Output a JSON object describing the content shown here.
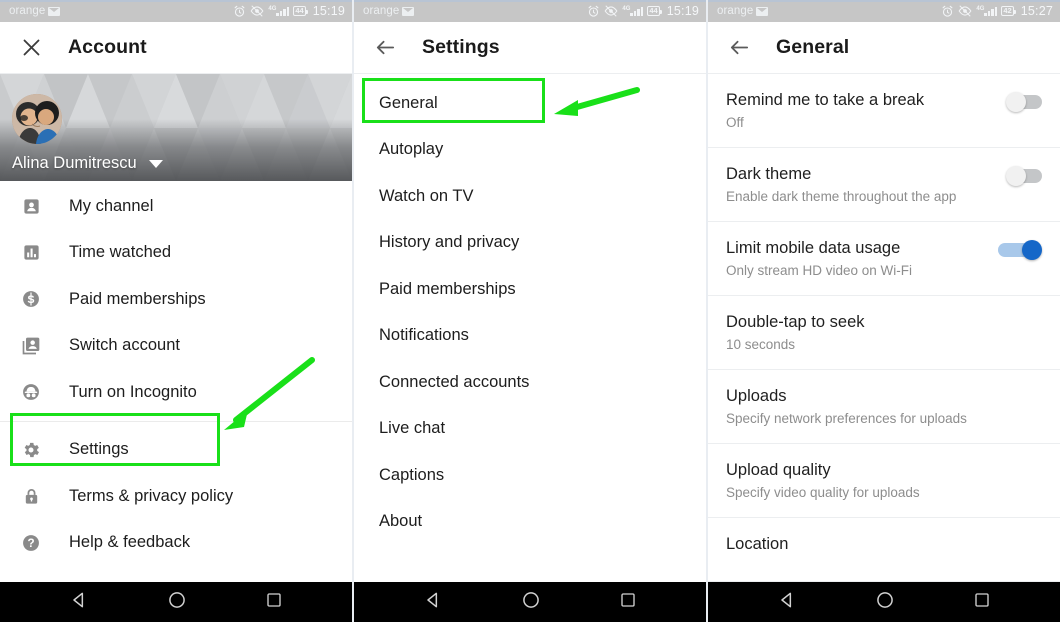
{
  "panels": [
    {
      "id": "account",
      "statusbar": {
        "carrier": "orange",
        "network": "4G",
        "battery": "44",
        "time": "15:19"
      },
      "appbar": {
        "nav_icon": "close-icon",
        "title": "Account"
      },
      "banner": {
        "account_name": "Alina Dumitrescu",
        "caret_icon": "chevron-down-icon",
        "avatar": "user-avatar"
      },
      "items": [
        {
          "label": "My channel",
          "icon": "account-box-icon"
        },
        {
          "label": "Time watched",
          "icon": "bar-chart-icon"
        },
        {
          "label": "Paid memberships",
          "icon": "dollar-circle-icon"
        },
        {
          "label": "Switch account",
          "icon": "switch-account-icon"
        },
        {
          "label": "Turn on Incognito",
          "icon": "incognito-icon"
        },
        {
          "label": "Settings",
          "icon": "gear-icon",
          "highlighted": true
        },
        {
          "label": "Terms & privacy policy",
          "icon": "lock-icon"
        },
        {
          "label": "Help & feedback",
          "icon": "help-circle-icon"
        }
      ]
    },
    {
      "id": "settings",
      "statusbar": {
        "carrier": "orange",
        "network": "4G",
        "battery": "44",
        "time": "15:19"
      },
      "appbar": {
        "nav_icon": "back-arrow-icon",
        "title": "Settings"
      },
      "items": [
        {
          "label": "General",
          "highlighted": true
        },
        {
          "label": "Autoplay"
        },
        {
          "label": "Watch on TV"
        },
        {
          "label": "History and privacy"
        },
        {
          "label": "Paid memberships"
        },
        {
          "label": "Notifications"
        },
        {
          "label": "Connected accounts"
        },
        {
          "label": "Live chat"
        },
        {
          "label": "Captions"
        },
        {
          "label": "About"
        }
      ]
    },
    {
      "id": "general",
      "statusbar": {
        "carrier": "orange",
        "network": "4G",
        "battery": "42",
        "time": "15:27"
      },
      "appbar": {
        "nav_icon": "back-arrow-icon",
        "title": "General"
      },
      "prefs": [
        {
          "title": "Remind me to take a break",
          "subtitle": "Off",
          "toggle": "off"
        },
        {
          "title": "Dark theme",
          "subtitle": "Enable dark theme throughout the app",
          "toggle": "off"
        },
        {
          "title": "Limit mobile data usage",
          "subtitle": "Only stream HD video on Wi-Fi",
          "toggle": "on"
        },
        {
          "title": "Double-tap to seek",
          "subtitle": "10 seconds",
          "toggle": "none"
        },
        {
          "title": "Uploads",
          "subtitle": "Specify network preferences for uploads",
          "toggle": "none"
        },
        {
          "title": "Upload quality",
          "subtitle": "Specify video quality for uploads",
          "toggle": "none"
        },
        {
          "title": "Location",
          "subtitle": "",
          "toggle": "none"
        }
      ]
    }
  ],
  "navbar": {
    "back": "back-triangle-icon",
    "home": "home-circle-icon",
    "recents": "recents-square-icon"
  },
  "annotation": {
    "color": "#19e019",
    "targets": [
      "Settings",
      "General"
    ]
  }
}
